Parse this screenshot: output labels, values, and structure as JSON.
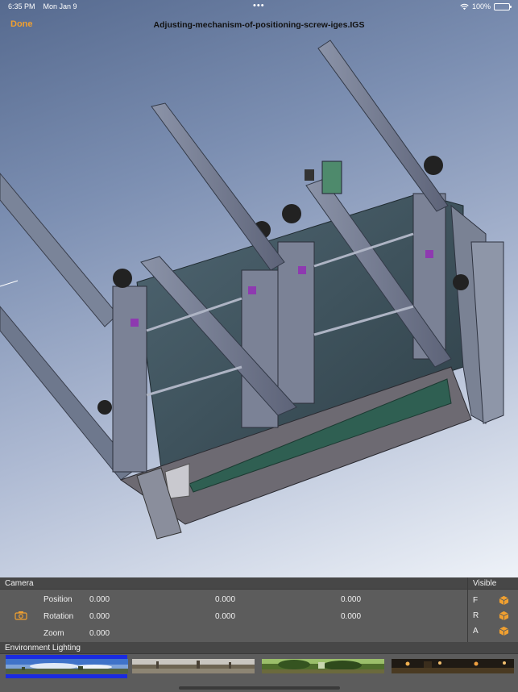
{
  "status_bar": {
    "time": "6:35 PM",
    "date": "Mon Jan 9",
    "dots": "•••",
    "battery": "100%"
  },
  "nav": {
    "done_label": "Done",
    "title": "Adjusting-mechanism-of-positioning-screw-iges.IGS"
  },
  "camera": {
    "header": "Camera",
    "rows": [
      {
        "label": "Position",
        "values": [
          "0.000",
          "0.000",
          "0.000"
        ]
      },
      {
        "label": "Rotation",
        "values": [
          "0.000",
          "0.000",
          "0.000"
        ]
      },
      {
        "label": "Zoom",
        "values": [
          "0.000"
        ]
      }
    ]
  },
  "visible": {
    "header": "Visible",
    "items": [
      {
        "label": "F",
        "icon": "cube-icon"
      },
      {
        "label": "R",
        "icon": "cube-icon"
      },
      {
        "label": "A",
        "icon": "cube-icon"
      }
    ]
  },
  "environment": {
    "header": "Environment Lighting",
    "selected_index": 0,
    "thumbnails": [
      "sky-panorama",
      "park-path-panorama",
      "forest-panorama",
      "night-street-panorama"
    ]
  },
  "colors": {
    "accent": "#f0a030",
    "selection": "#1a2be0",
    "panel": "#5c5c5c",
    "panel_header": "#474747"
  }
}
